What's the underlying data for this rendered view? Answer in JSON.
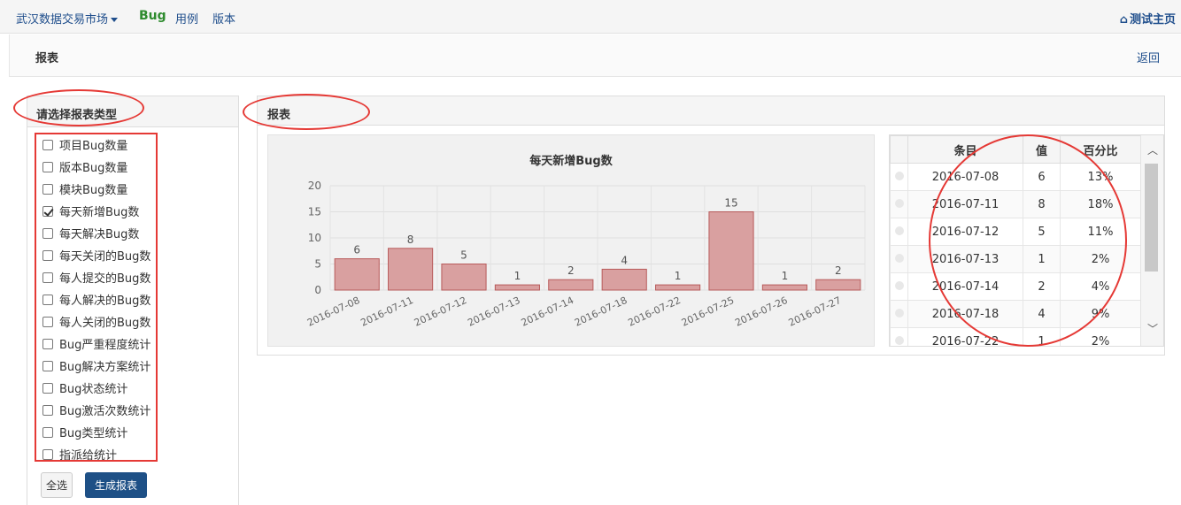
{
  "nav": {
    "brand": "武汉数据交易市场",
    "bug": "Bug",
    "case": "用例",
    "version": "版本",
    "home": "测试主页"
  },
  "page": {
    "title": "报表",
    "back": "返回"
  },
  "left": {
    "title": "请选择报表类型",
    "items": [
      {
        "label": "项目Bug数量",
        "checked": false
      },
      {
        "label": "版本Bug数量",
        "checked": false
      },
      {
        "label": "模块Bug数量",
        "checked": false
      },
      {
        "label": "每天新增Bug数",
        "checked": true
      },
      {
        "label": "每天解决Bug数",
        "checked": false
      },
      {
        "label": "每天关闭的Bug数",
        "checked": false
      },
      {
        "label": "每人提交的Bug数",
        "checked": false
      },
      {
        "label": "每人解决的Bug数",
        "checked": false
      },
      {
        "label": "每人关闭的Bug数",
        "checked": false
      },
      {
        "label": "Bug严重程度统计",
        "checked": false
      },
      {
        "label": "Bug解决方案统计",
        "checked": false
      },
      {
        "label": "Bug状态统计",
        "checked": false
      },
      {
        "label": "Bug激活次数统计",
        "checked": false
      },
      {
        "label": "Bug类型统计",
        "checked": false
      },
      {
        "label": "指派给统计",
        "checked": false
      }
    ],
    "select_all": "全选",
    "generate": "生成报表"
  },
  "right": {
    "title": "报表"
  },
  "chart_data": {
    "type": "bar",
    "title": "每天新增Bug数",
    "categories": [
      "2016-07-08",
      "2016-07-11",
      "2016-07-12",
      "2016-07-13",
      "2016-07-14",
      "2016-07-18",
      "2016-07-22",
      "2016-07-25",
      "2016-07-26",
      "2016-07-27"
    ],
    "values": [
      6,
      8,
      5,
      1,
      2,
      4,
      1,
      15,
      1,
      2
    ],
    "ylim": [
      0,
      20
    ],
    "yticks": [
      0,
      5,
      10,
      15,
      20
    ],
    "grid": true,
    "bar_color": "#d9a0a0",
    "bar_border": "#b85a5a"
  },
  "table": {
    "headers": [
      "条目",
      "值",
      "百分比"
    ],
    "rows": [
      [
        "2016-07-08",
        "6",
        "13%"
      ],
      [
        "2016-07-11",
        "8",
        "18%"
      ],
      [
        "2016-07-12",
        "5",
        "11%"
      ],
      [
        "2016-07-13",
        "1",
        "2%"
      ],
      [
        "2016-07-14",
        "2",
        "4%"
      ],
      [
        "2016-07-18",
        "4",
        "9%"
      ],
      [
        "2016-07-22",
        "1",
        "2%"
      ]
    ]
  },
  "colors": {
    "accent": "#1e5086",
    "link": "#1f4e8c",
    "annotation": "#e53935"
  }
}
